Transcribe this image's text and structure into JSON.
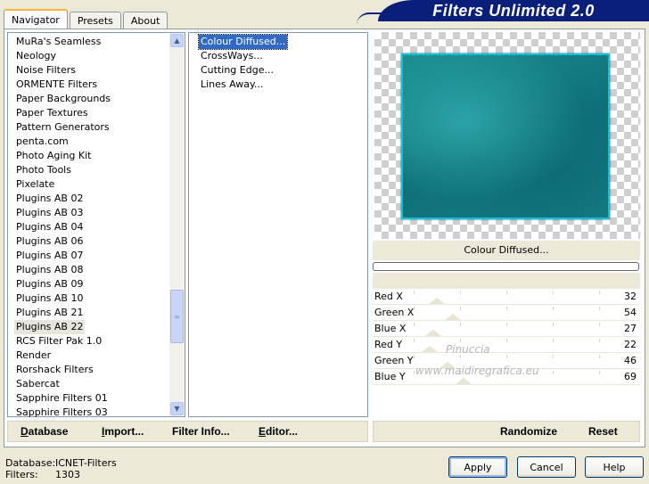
{
  "tabs": [
    {
      "label": "Navigator",
      "active": true
    },
    {
      "label": "Presets",
      "active": false
    },
    {
      "label": "About",
      "active": false
    }
  ],
  "banner_title": "Filters Unlimited 2.0",
  "categories": [
    "MuRa's Seamless",
    "Neology",
    "Noise Filters",
    "ORMENTE Filters",
    "Paper Backgrounds",
    "Paper Textures",
    "Pattern Generators",
    "penta.com",
    "Photo Aging Kit",
    "Photo Tools",
    "Pixelate",
    "Plugins AB 02",
    "Plugins AB 03",
    "Plugins AB 04",
    "Plugins AB 06",
    "Plugins AB 07",
    "Plugins AB 08",
    "Plugins AB 09",
    "Plugins AB 10",
    "Plugins AB 21",
    "Plugins AB 22",
    "RCS Filter Pak 1.0",
    "Render",
    "Rorshack Filters",
    "Sabercat",
    "Sapphire Filters 01",
    "Sapphire Filters 03"
  ],
  "selected_category": "Plugins AB 22",
  "filters": [
    "Colour Diffused...",
    "CrossWays...",
    "Cutting Edge...",
    "Lines Away..."
  ],
  "selected_filter": "Colour Diffused...",
  "preview_filter_name": "Colour Diffused...",
  "parameters": [
    {
      "label": "Red X",
      "value": 32
    },
    {
      "label": "Green X",
      "value": 54
    },
    {
      "label": "Blue X",
      "value": 27
    },
    {
      "label": "Red Y",
      "value": 22
    },
    {
      "label": "Green Y",
      "value": 46
    },
    {
      "label": "Blue Y",
      "value": 69
    }
  ],
  "watermark": {
    "line1": "Pinuccia",
    "line2": "www.maidiregrafica.eu"
  },
  "toolbar_left": [
    {
      "label": "Database",
      "underline": "D",
      "rest": "atabase"
    },
    {
      "label": "Import...",
      "underline": "I",
      "rest": "mport..."
    },
    {
      "label": "Filter Info...",
      "underline": "",
      "rest": "Filter Info..."
    },
    {
      "label": "Editor...",
      "underline": "E",
      "rest": "ditor..."
    }
  ],
  "toolbar_right": [
    {
      "label": "Randomize"
    },
    {
      "label": "Reset"
    }
  ],
  "status": {
    "database_label": "Database:",
    "database_value": "ICNET-Filters",
    "filters_label": "Filters:",
    "filters_value": "1303"
  },
  "buttons": {
    "apply": "Apply",
    "cancel": "Cancel",
    "help": "Help"
  },
  "colors": {
    "accent": "#0a1f7a",
    "selection": "#316ac5",
    "preview_fill": "#1a8c90"
  }
}
